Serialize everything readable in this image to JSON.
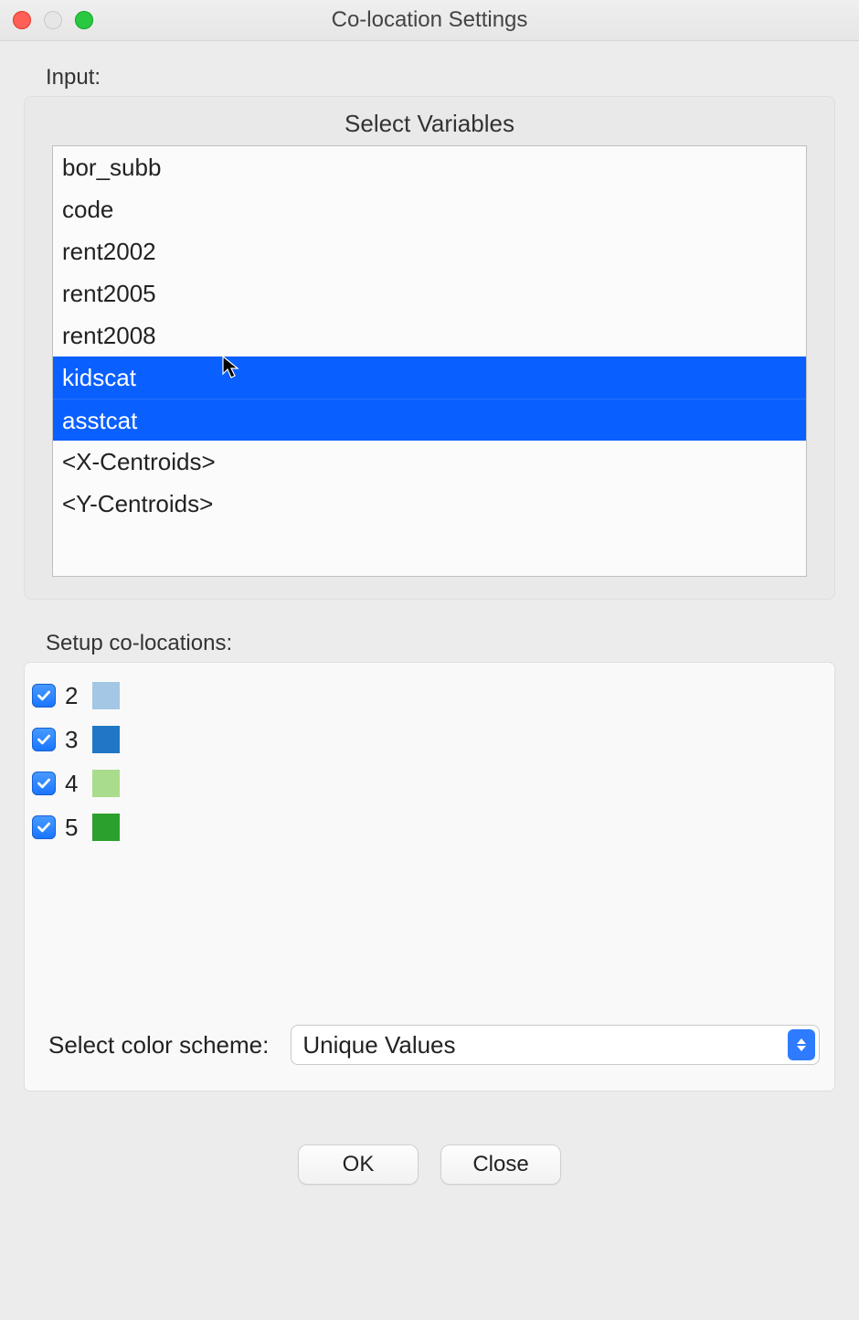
{
  "window": {
    "title": "Co-location Settings"
  },
  "input": {
    "label": "Input:",
    "panel_title": "Select Variables",
    "variables": [
      {
        "name": "bor_subb",
        "selected": false
      },
      {
        "name": "code",
        "selected": false
      },
      {
        "name": "rent2002",
        "selected": false
      },
      {
        "name": "rent2005",
        "selected": false
      },
      {
        "name": "rent2008",
        "selected": false
      },
      {
        "name": "kidscat",
        "selected": true
      },
      {
        "name": "asstcat",
        "selected": true
      },
      {
        "name": "<X-Centroids>",
        "selected": false
      },
      {
        "name": "<Y-Centroids>",
        "selected": false
      }
    ]
  },
  "setup": {
    "label": "Setup co-locations:",
    "rows": [
      {
        "checked": true,
        "value": "2",
        "color": "#a3c7e4"
      },
      {
        "checked": true,
        "value": "3",
        "color": "#1f77c6"
      },
      {
        "checked": true,
        "value": "4",
        "color": "#a9dc8d"
      },
      {
        "checked": true,
        "value": "5",
        "color": "#2ca02c"
      }
    ],
    "scheme_label": "Select color scheme:",
    "scheme_value": "Unique Values"
  },
  "buttons": {
    "ok": "OK",
    "close": "Close"
  }
}
